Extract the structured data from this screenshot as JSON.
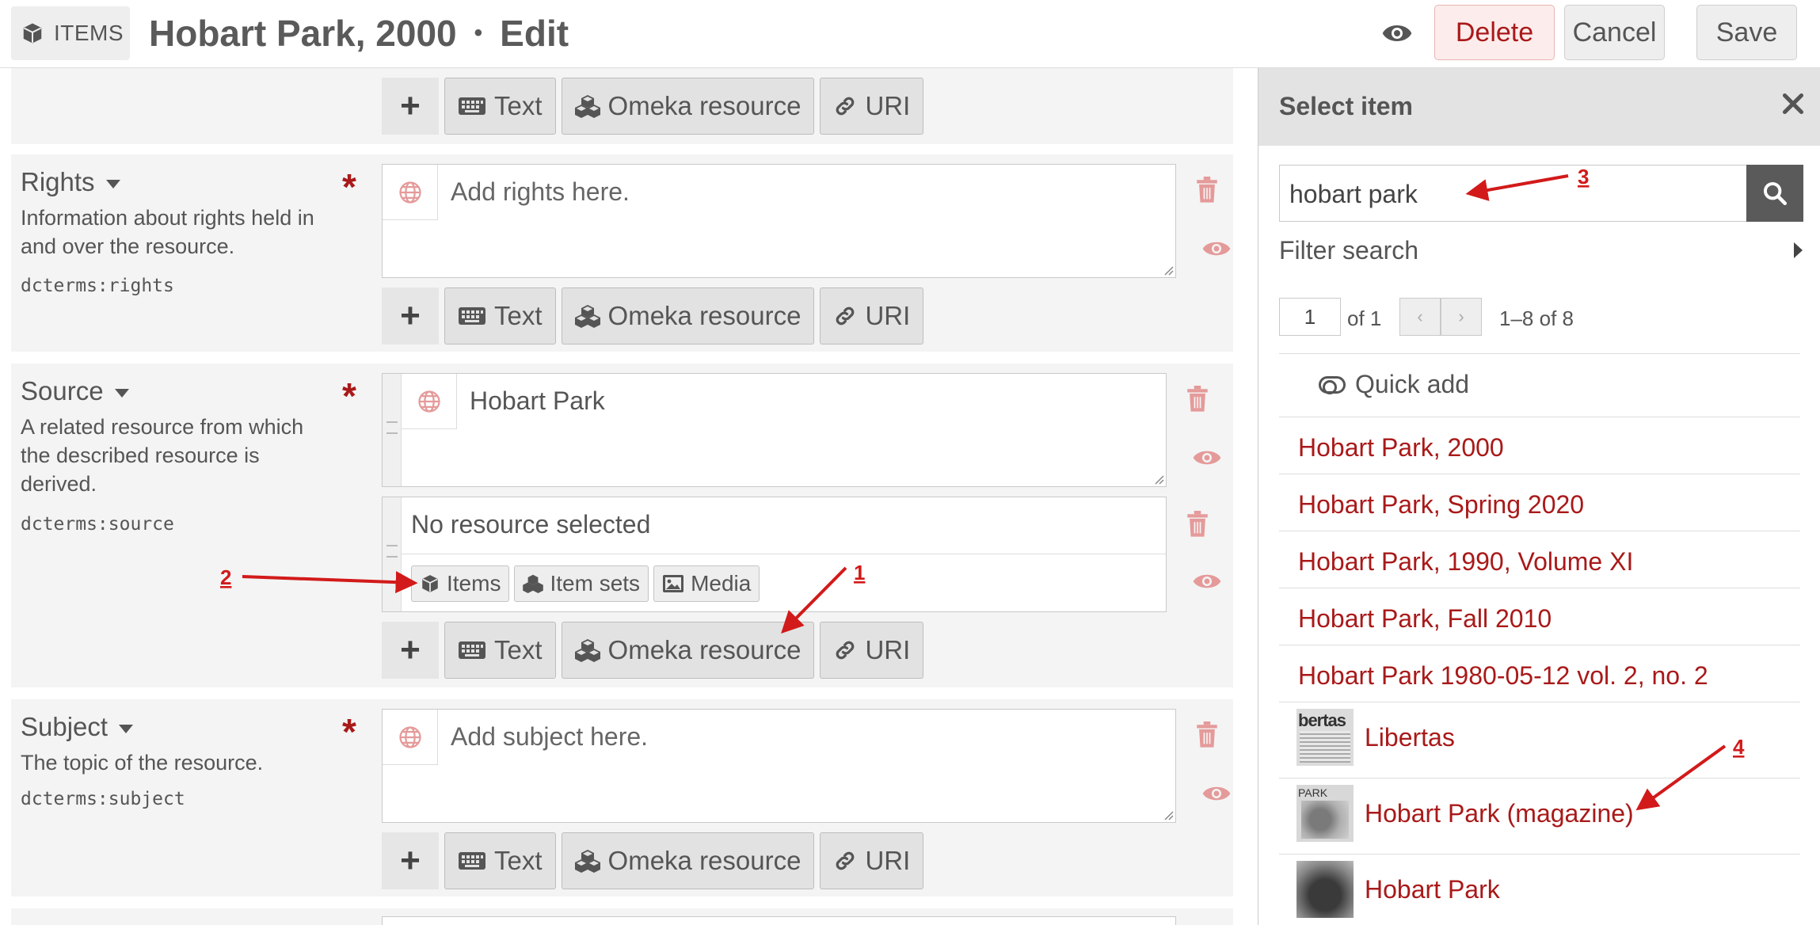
{
  "header": {
    "badge_label": "ITEMS",
    "title": "Hobart Park, 2000",
    "title_separator": "•",
    "mode": "Edit",
    "delete_label": "Delete",
    "cancel_label": "Cancel",
    "save_label": "Save"
  },
  "add_buttons": {
    "text": "Text",
    "omeka_resource": "Omeka resource",
    "uri": "URI"
  },
  "properties": {
    "rights": {
      "label": "Rights",
      "description": "Information about rights held in and over the resource.",
      "term": "dcterms:rights",
      "placeholder": "Add rights here."
    },
    "source": {
      "label": "Source",
      "description": "A related resource from which the described resource is derived.",
      "term": "dcterms:source",
      "value": "Hobart Park",
      "resource_status": "No resource selected",
      "resource_buttons": {
        "items": "Items",
        "item_sets": "Item sets",
        "media": "Media"
      }
    },
    "subject": {
      "label": "Subject",
      "description": "The topic of the resource.",
      "term": "dcterms:subject",
      "placeholder": "Add subject here."
    }
  },
  "sidebar": {
    "title": "Select item",
    "search_value": "hobart park",
    "filter_label": "Filter search",
    "page_current": "1",
    "page_of": "of 1",
    "range": "1–8 of 8",
    "quick_add": "Quick add",
    "results": [
      {
        "title": "Hobart Park, 2000"
      },
      {
        "title": "Hobart Park, Spring 2020"
      },
      {
        "title": "Hobart Park, 1990, Volume XI"
      },
      {
        "title": "Hobart Park, Fall 2010"
      },
      {
        "title": "Hobart Park 1980-05-12 vol. 2, no. 2"
      },
      {
        "title": "Libertas",
        "thumb_text": "bertas"
      },
      {
        "title": "Hobart Park (magazine)",
        "thumb_text": "PARK"
      },
      {
        "title": "Hobart Park"
      }
    ]
  },
  "annotations": {
    "n1": "1",
    "n2": "2",
    "n3": "3",
    "n4": "4"
  },
  "colors": {
    "accent_red": "#a91919",
    "annotation_red": "#d21a1a",
    "panel_gray": "#f4f4f4"
  },
  "icons": [
    "cube-icon",
    "eye-icon",
    "plus-icon",
    "keyboard-icon",
    "cubes-icon",
    "link-icon",
    "globe-icon",
    "trash-icon",
    "close-icon",
    "search-icon",
    "toggle-icon",
    "image-icon"
  ]
}
